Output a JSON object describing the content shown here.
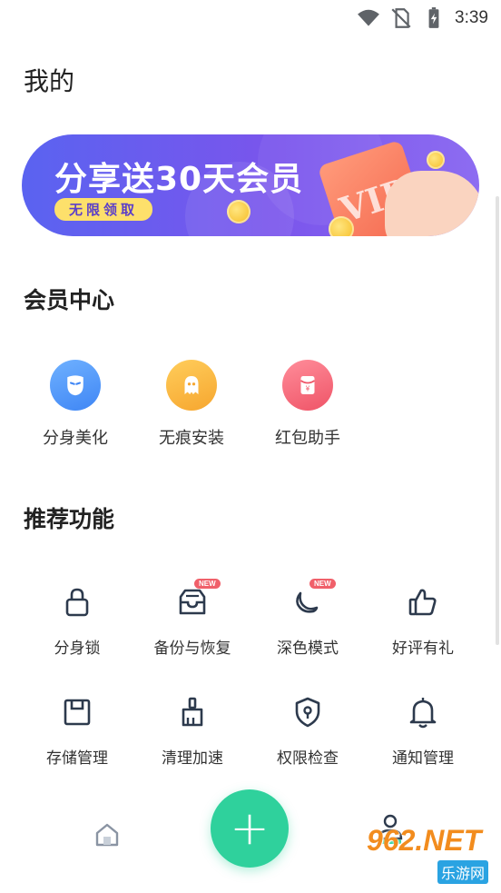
{
  "status_bar": {
    "time": "3:39",
    "icons": [
      "wifi-icon",
      "no-sim-icon",
      "battery-charging-icon"
    ]
  },
  "page": {
    "title": "我的"
  },
  "banner": {
    "title": "分享送30天会员",
    "tag": "无限领取",
    "card_text": "VIP"
  },
  "member_center": {
    "title": "会员中心",
    "items": [
      {
        "label": "分身美化",
        "icon": "mask-icon",
        "color": "#4a8ff7"
      },
      {
        "label": "无痕安装",
        "icon": "ghost-icon",
        "color": "#f8b43c"
      },
      {
        "label": "红包助手",
        "icon": "red-envelope-icon",
        "color": "#f2606f"
      }
    ]
  },
  "recommended": {
    "title": "推荐功能",
    "items": [
      {
        "label": "分身锁",
        "icon": "lock-icon",
        "badge": ""
      },
      {
        "label": "备份与恢复",
        "icon": "inbox-icon",
        "badge": "NEW"
      },
      {
        "label": "深色模式",
        "icon": "moon-icon",
        "badge": "NEW"
      },
      {
        "label": "好评有礼",
        "icon": "thumbs-up-icon",
        "badge": ""
      },
      {
        "label": "存储管理",
        "icon": "storage-icon",
        "badge": ""
      },
      {
        "label": "清理加速",
        "icon": "broom-icon",
        "badge": ""
      },
      {
        "label": "权限检查",
        "icon": "shield-icon",
        "badge": ""
      },
      {
        "label": "通知管理",
        "icon": "bell-icon",
        "badge": ""
      }
    ]
  },
  "bottom_nav": {
    "home_icon": "home-icon",
    "fab_symbol": "+",
    "me_icon": "user-icon"
  },
  "watermark": {
    "number": "962.NET",
    "site": "乐游网"
  },
  "colors": {
    "accent": "#2fd19c",
    "icon_stroke": "#2d3a4d",
    "banner_start": "#5a63f0",
    "banner_end": "#8d6cf1",
    "badge": "#f0606a"
  }
}
